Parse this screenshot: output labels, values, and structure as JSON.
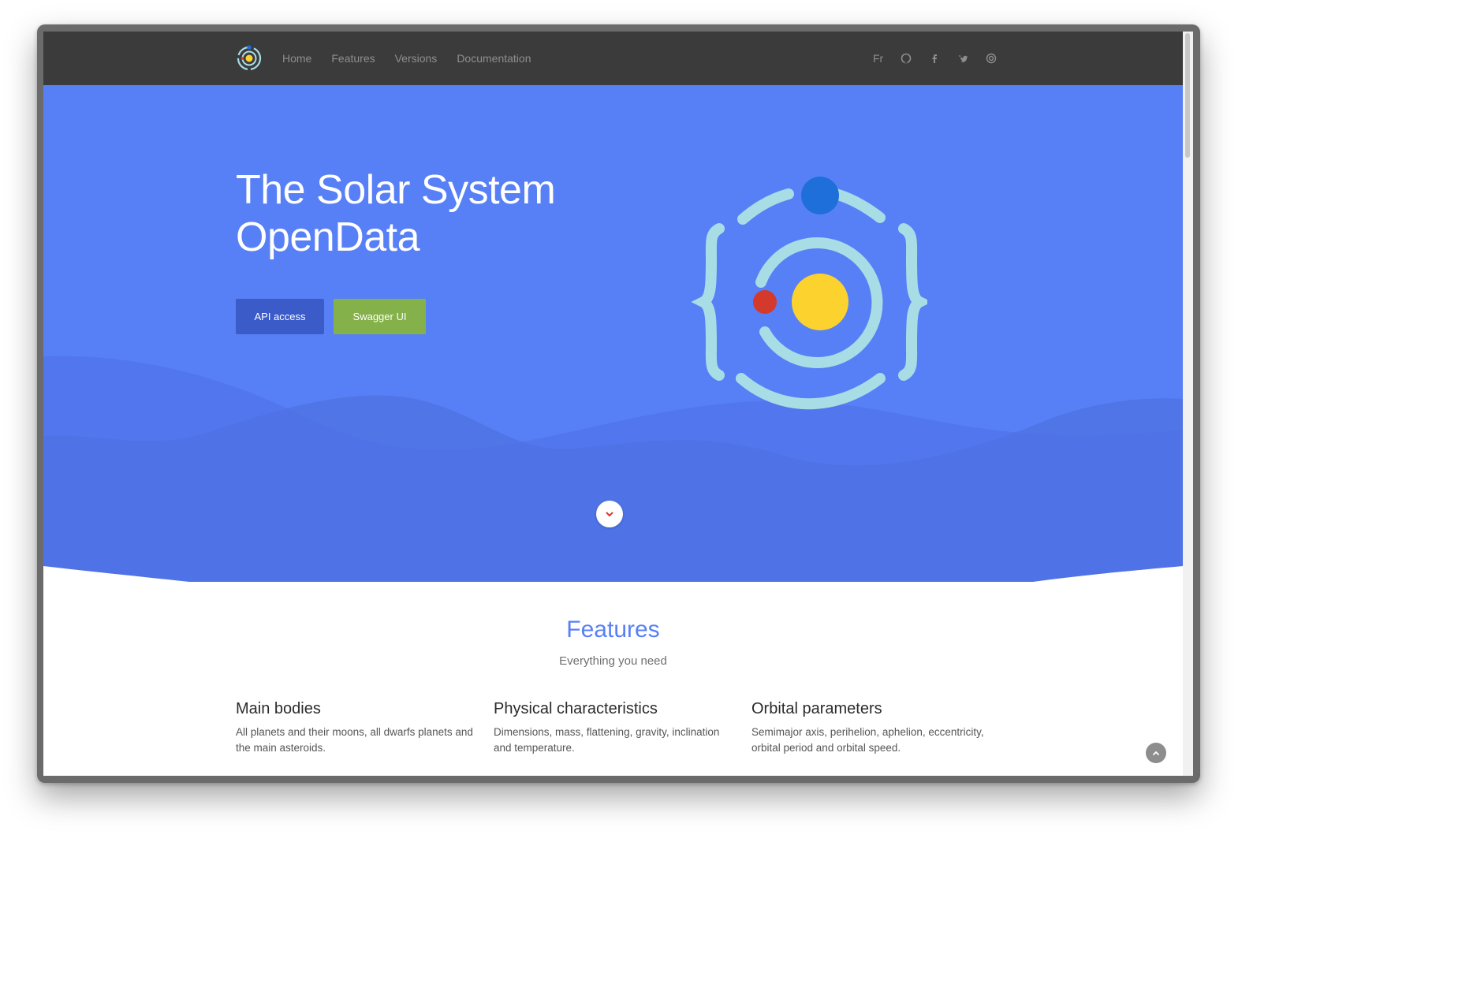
{
  "nav": {
    "links": [
      "Home",
      "Features",
      "Versions",
      "Documentation"
    ],
    "language": "Fr",
    "icons": [
      "github-icon",
      "facebook-icon",
      "twitter-icon",
      "rss-icon"
    ]
  },
  "hero": {
    "title_line1": "The Solar System",
    "title_line2": "OpenData",
    "api_button": "API access",
    "swagger_button": "Swagger UI"
  },
  "features": {
    "title": "Features",
    "subtitle": "Everything you need",
    "items": [
      {
        "title": "Main bodies",
        "text": "All planets and their moons, all dwarfs planets and the main asteroids."
      },
      {
        "title": "Physical characteristics",
        "text": "Dimensions, mass, flattening, gravity, inclination and temperature."
      },
      {
        "title": "Orbital parameters",
        "text": "Semimajor axis, perihelion, aphelion, eccentricity, orbital period and orbital speed."
      }
    ]
  },
  "colors": {
    "navbar": "#3b3b3b",
    "hero": "#5880f6",
    "api_button": "#3b5bc9",
    "swagger_button": "#84b14a",
    "features_title": "#5880f6"
  }
}
